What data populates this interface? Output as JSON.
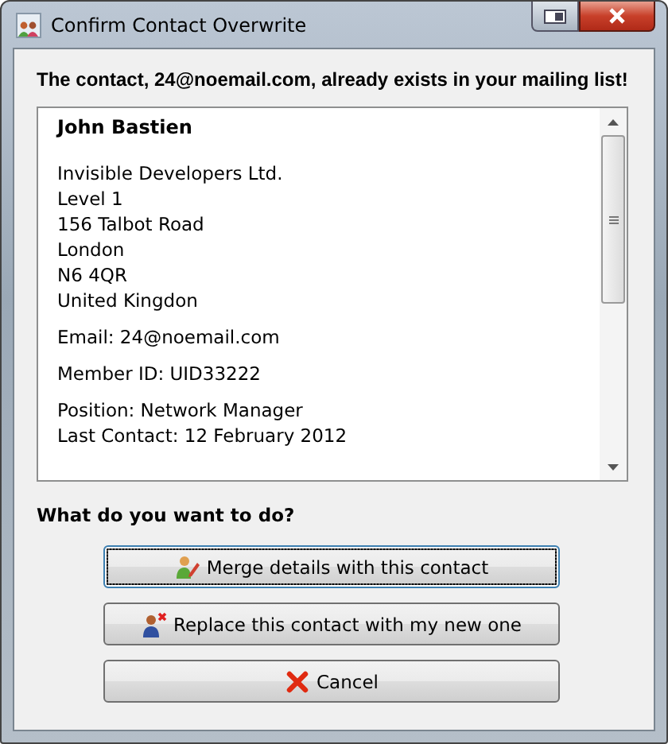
{
  "window": {
    "title": "Confirm Contact Overwrite"
  },
  "message": "The contact, 24@noemail.com, already exists in your mailing list!",
  "contact": {
    "name": "John Bastien",
    "sections": [
      [
        "Invisible Developers Ltd.",
        "Level 1",
        "156 Talbot Road",
        "London",
        "N6 4QR",
        "United Kingdon"
      ],
      [
        "Email: 24@noemail.com"
      ],
      [
        "Member ID: UID33222"
      ],
      [
        "Position: Network Manager",
        "Last Contact: 12 February 2012"
      ]
    ]
  },
  "question": "What do you want to do?",
  "buttons": [
    {
      "label": "Merge details with this contact",
      "kind": "merge",
      "focused": true
    },
    {
      "label": "Replace this contact with my new one",
      "kind": "replace",
      "focused": false
    },
    {
      "label": "Cancel",
      "kind": "cancel",
      "focused": false
    }
  ]
}
